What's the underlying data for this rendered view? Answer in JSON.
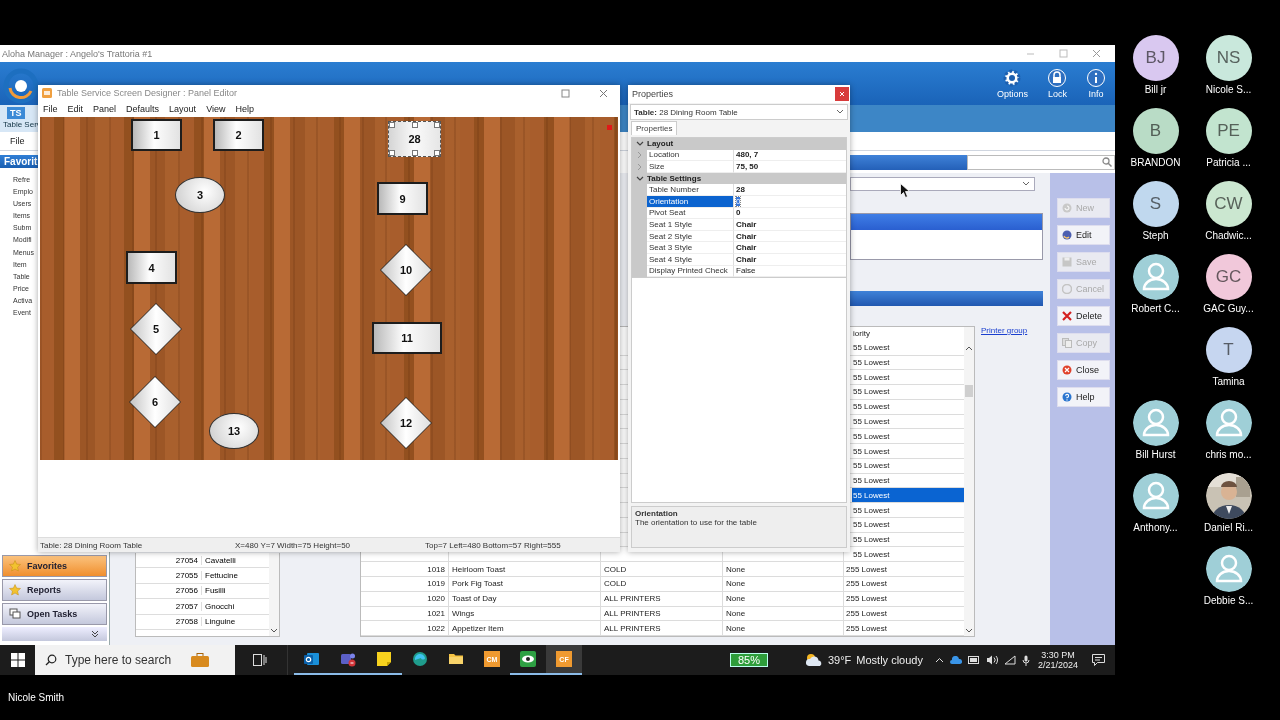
{
  "app_window": {
    "title": "Aloha Manager : Angelo's Trattoria #1",
    "toolbar": [
      {
        "kind": "gear",
        "label": "Options"
      },
      {
        "kind": "lock",
        "label": "Lock"
      },
      {
        "kind": "info",
        "label": "Info"
      }
    ],
    "ribbon_tab": {
      "badge": "TS",
      "label": "Table Serv"
    },
    "menu": [
      "File"
    ],
    "sidebar": {
      "header": "Favorit",
      "items": [
        "Refre",
        "Emplo",
        "Users",
        "Items",
        "Subm",
        "Modifi",
        "Menus",
        "Item",
        "Table",
        "Price",
        "Activa",
        "Event"
      ],
      "nav": [
        {
          "kind": "star",
          "label": "Favorites",
          "selected": true
        },
        {
          "kind": "star",
          "label": "Reports",
          "selected": false
        },
        {
          "kind": "tasks",
          "label": "Open Tasks",
          "selected": false
        }
      ]
    },
    "code_list": {
      "rows": [
        {
          "code": "27054",
          "name": "Cavatelli"
        },
        {
          "code": "27055",
          "name": "Fettucine"
        },
        {
          "code": "27056",
          "name": "Fusilli"
        },
        {
          "code": "27057",
          "name": "Gnocchi"
        },
        {
          "code": "27058",
          "name": "Linguine"
        }
      ]
    },
    "items_table": {
      "header": "iority",
      "rows": [
        {
          "priority": "55 Lowest",
          "selected": false
        },
        {
          "priority": "55 Lowest",
          "selected": false
        },
        {
          "priority": "55 Lowest",
          "selected": false
        },
        {
          "priority": "55 Lowest",
          "selected": false
        },
        {
          "priority": "55 Lowest",
          "selected": false
        },
        {
          "priority": "55 Lowest",
          "selected": false
        },
        {
          "priority": "55 Lowest",
          "selected": false
        },
        {
          "priority": "55 Lowest",
          "selected": false
        },
        {
          "priority": "55 Lowest",
          "selected": false
        },
        {
          "priority": "55 Lowest",
          "selected": false
        },
        {
          "priority": "55 Lowest",
          "selected": true
        },
        {
          "priority": "55 Lowest",
          "selected": false
        },
        {
          "priority": "55 Lowest",
          "selected": false
        },
        {
          "priority": "55 Lowest",
          "selected": false
        },
        {
          "priority": "55 Lowest",
          "selected": false
        },
        {
          "number": "1018",
          "name": "Heirloom Toast",
          "printer": "COLD",
          "column_4": "None",
          "priority": "255 Lowest",
          "selected": false
        },
        {
          "number": "1019",
          "name": "Pork Fig Toast",
          "printer": "COLD",
          "column_4": "None",
          "priority": "255 Lowest",
          "selected": false
        },
        {
          "number": "1020",
          "name": "Toast of Day",
          "printer": "ALL PRINTERS",
          "column_4": "None",
          "priority": "255 Lowest",
          "selected": false
        },
        {
          "number": "1021",
          "name": "Wings",
          "printer": "ALL PRINTERS",
          "column_4": "None",
          "priority": "255 Lowest",
          "selected": false
        },
        {
          "number": "1022",
          "name": "Appetizer Item",
          "printer": "ALL PRINTERS",
          "column_4": "None",
          "priority": "255 Lowest",
          "selected": false
        }
      ]
    },
    "printer_group_link": "Printer group",
    "actions": [
      {
        "kind": "new",
        "label": "New",
        "disabled": true
      },
      {
        "kind": "edit",
        "label": "Edit",
        "disabled": false
      },
      {
        "kind": "save",
        "label": "Save",
        "disabled": true
      },
      {
        "kind": "cancel",
        "label": "Cancel",
        "disabled": true
      },
      {
        "kind": "delete",
        "label": "Delete",
        "disabled": false
      },
      {
        "kind": "copy",
        "label": "Copy",
        "disabled": true
      },
      {
        "kind": "close",
        "label": "Close",
        "disabled": false
      },
      {
        "kind": "help",
        "label": "Help",
        "disabled": false
      }
    ]
  },
  "panel_editor": {
    "title": "Table Service Screen Designer : Panel Editor",
    "menu": [
      "File",
      "Edit",
      "Panel",
      "Defaults",
      "Layout",
      "View",
      "Help"
    ],
    "tables": [
      {
        "number": "1",
        "kind": "rect",
        "selected": false
      },
      {
        "number": "2",
        "kind": "rect",
        "selected": false
      },
      {
        "number": "28",
        "kind": "rect",
        "selected": true
      },
      {
        "number": "3",
        "kind": "circle",
        "selected": false
      },
      {
        "number": "9",
        "kind": "rect",
        "selected": false
      },
      {
        "number": "4",
        "kind": "rect",
        "selected": false
      },
      {
        "number": "10",
        "kind": "diamond",
        "selected": false
      },
      {
        "number": "5",
        "kind": "diamond",
        "selected": false
      },
      {
        "number": "11",
        "kind": "rect",
        "selected": false
      },
      {
        "number": "6",
        "kind": "diamond",
        "selected": false
      },
      {
        "number": "13",
        "kind": "circle",
        "selected": false
      },
      {
        "number": "12",
        "kind": "diamond",
        "selected": false
      }
    ],
    "status": [
      "Table: 28 Dining Room Table",
      "X=480 Y=7 Width=75 Height=50",
      "Top=7 Left=480 Bottom=57 Right=555"
    ]
  },
  "properties": {
    "title": "Properties",
    "object": "**Table:** 28 Dining Room Table",
    "tab": "Properties",
    "categories": [
      {
        "name": "Layout",
        "expanded": true,
        "children": [
          {
            "name": "Location",
            "value": "480, 7",
            "expandable": true,
            "modified": true,
            "selected": false
          },
          {
            "name": "Size",
            "value": "75, 50",
            "expandable": true,
            "modified": true,
            "selected": false
          }
        ]
      },
      {
        "name": "Table Settings",
        "expanded": true,
        "children": [
          {
            "name": "Table Number",
            "value": "28",
            "expandable": false,
            "modified": true,
            "selected": false
          },
          {
            "name": "Orientation",
            "value": "0",
            "expandable": false,
            "modified": false,
            "selected": true
          },
          {
            "name": "Pivot Seat",
            "value": "0",
            "expandable": false,
            "modified": true,
            "selected": false
          },
          {
            "name": "Seat 1 Style",
            "value": "Chair",
            "expandable": false,
            "modified": true,
            "selected": false
          },
          {
            "name": "Seat 2 Style",
            "value": "Chair",
            "expandable": false,
            "modified": true,
            "selected": false
          },
          {
            "name": "Seat 3 Style",
            "value": "Chair",
            "expandable": false,
            "modified": true,
            "selected": false
          },
          {
            "name": "Seat 4 Style",
            "value": "Chair",
            "expandable": false,
            "modified": true,
            "selected": false
          },
          {
            "name": "Display Printed Check",
            "value": "False",
            "expandable": false,
            "modified": false,
            "selected": false
          }
        ]
      }
    ],
    "description": {
      "title": "Orientation",
      "text": "The orientation to use for the table"
    }
  },
  "taskbar": {
    "search": {
      "placeholder": "Type here to search"
    },
    "apps": [
      {
        "kind": "outlook",
        "running": true,
        "selected": false
      },
      {
        "kind": "teams",
        "running": true,
        "selected": false
      },
      {
        "kind": "notes",
        "running": true,
        "selected": false
      },
      {
        "kind": "edge",
        "running": false,
        "selected": false
      },
      {
        "kind": "folder",
        "running": false,
        "selected": false
      },
      {
        "kind": "letters",
        "label": "CM",
        "running": false,
        "selected": false
      },
      {
        "kind": "eye",
        "running": true,
        "selected": false
      },
      {
        "kind": "letters",
        "label": "CF",
        "running": true,
        "selected": true
      }
    ],
    "battery": "85%",
    "temperature": "39°F",
    "weather": "Mostly cloudy",
    "time": "3:30 PM",
    "date": "2/21/2024"
  },
  "participants": [
    [
      {
        "kind": "initials",
        "initials": "BJ",
        "name": "Bill jr",
        "color": "#d9c8f0"
      },
      {
        "kind": "initials",
        "initials": "NS",
        "name": "Nicole S...",
        "color": "#c9e8dc"
      }
    ],
    [
      {
        "kind": "initials",
        "initials": "B",
        "name": "BRANDON",
        "color": "#b9dcc6"
      },
      {
        "kind": "initials",
        "initials": "PE",
        "name": "Patricia ...",
        "color": "#c2e4cf"
      }
    ],
    [
      {
        "kind": "initials",
        "initials": "S",
        "name": "Steph",
        "color": "#c0d8ee"
      },
      {
        "kind": "initials",
        "initials": "CW",
        "name": "Chadwic...",
        "color": "#cbe7d0"
      }
    ],
    [
      {
        "kind": "silhouette",
        "name": "Robert C...",
        "color": "#9fcfd7"
      },
      {
        "kind": "initials",
        "initials": "GC",
        "name": "GAC Guy...",
        "color": "#f1c8da"
      }
    ],
    [
      {
        "kind": "initials",
        "initials": "T",
        "name": "Tamina",
        "color": "#c6d6f0"
      }
    ],
    [
      {
        "kind": "silhouette",
        "name": "Bill Hurst",
        "color": "#9fcfd7"
      },
      {
        "kind": "silhouette",
        "name": "chris mo...",
        "color": "#9fcfd7"
      }
    ],
    [
      {
        "kind": "silhouette",
        "name": "Anthony...",
        "color": "#9fcfd7"
      },
      {
        "name": "Daniel Ri..."
      }
    ],
    [
      {
        "kind": "silhouette",
        "name": "Debbie S...",
        "color": "#9fcfd7"
      }
    ]
  ],
  "presenter": "Nicole Smith"
}
